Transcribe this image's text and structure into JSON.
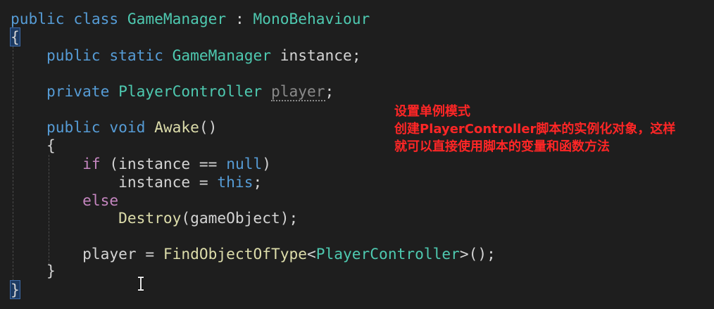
{
  "annotation": {
    "lines": [
      "设置单例模式",
      "创建PlayerController脚本的实例化对象，这样",
      "就可以直接使用脚本的变量和函数方法"
    ],
    "color": "#ff2626"
  },
  "code": {
    "l1": {
      "kw_public": "public",
      "kw_class": "class",
      "class_name": "GameManager",
      "colon": " : ",
      "base_class": "MonoBehaviour"
    },
    "l2": {
      "open_brace": "{"
    },
    "l3": {
      "kw_public": "public",
      "kw_static": "static",
      "type": "GameManager",
      "field": "instance",
      "semi": ";"
    },
    "l4": {
      "kw_private": "private",
      "type": "PlayerController",
      "field": "player",
      "semi": ";"
    },
    "l5": {
      "kw_public": "public",
      "kw_void": "void",
      "method": "Awake",
      "parens": "()"
    },
    "l6": {
      "open_brace": "{"
    },
    "l7": {
      "kw_if": "if",
      "open": " (",
      "ident": "instance",
      "op": " == ",
      "kw_null": "null",
      "close": ")"
    },
    "l8": {
      "ident": "instance",
      "op": " = ",
      "kw_this": "this",
      "semi": ";"
    },
    "l9": {
      "kw_else": "else"
    },
    "l10": {
      "method": "Destroy",
      "open": "(",
      "arg": "gameObject",
      "close": ");"
    },
    "l11": {
      "ident": "player",
      "op": " = ",
      "method": "FindObjectOfType",
      "lt": "<",
      "type": "PlayerController",
      "gt_call": ">();"
    },
    "l12": {
      "close_brace": "}"
    },
    "l13": {
      "close_brace": "}"
    }
  },
  "colors": {
    "background": "#1e1e1e",
    "keyword": "#569cd6",
    "type": "#4ec9b0",
    "method": "#dcdcaa",
    "control": "#c586c0",
    "text": "#d4d4d4"
  },
  "icons": {
    "cursor": "text-cursor-ibeam-icon"
  }
}
